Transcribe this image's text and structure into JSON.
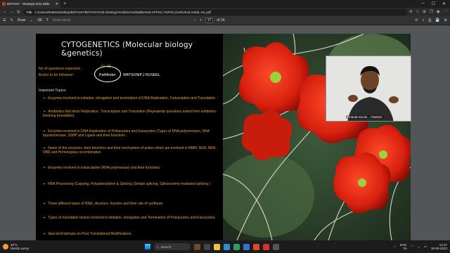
{
  "browser": {
    "tab_title": "BOTANY - Strategic time table",
    "address_prefix": "File",
    "url": "C:/Users/91961/Desktop/BOTANY/BOTANY%20-Strategic%20time%20table%20-APPSC,TSPSC,GURUKUL%20IL-DL.pdf"
  },
  "pdf_toolbar": {
    "draw_label": "Draw",
    "read_aloud_label": "Read aloud",
    "page_current": "17",
    "page_total": "of 24"
  },
  "slide": {
    "title": "CYTOGENETICS (Molecular biology &genetics)",
    "questions_label": "No of questions expected :",
    "questions_value": "10- 15",
    "books_label": "Books to be followed :",
    "book1": "Pathfinder",
    "book2": "WATSON/P.J RUSEEL",
    "topics_heading": "Important Topics:",
    "topics": [
      "Enzymes involved in initiation, elongation and termination of DNA Replication, Transcription and Translation.",
      "Antibiotics that block Replication, Transcription and Translation (Repeatedly questions asked from antibiotics blocking translation)",
      "Enzymes involved in DNA Replication of Prokaryotes and Eukaryotes (Types of DNA polymerases, DNA topoisomerase, SSBP and Ligase and their functions .",
      "Name of the enzymes, their functions and their mechanism of action which are involved in MMR, NER, BER, DBR and Homologous recombination",
      "Enzymes involved in transcription (RNA polymerase) and their functions.",
      "RNA Processing (Capping, Polyadenylation & Splicing (Simple splicing, Spliceosome mediated splicing )",
      "Three different types of RNA, structure, function and their site of synthesis",
      "Types of translation factors involved in initiation, elongation and Termination of Prokaryotes and Eukaryotes.",
      "Special Emphasis on Post Translational Modifications."
    ]
  },
  "webcam": {
    "label": "Chandu Ecolo... Classes"
  },
  "taskbar": {
    "temperature": "30°C",
    "weather": "Mostly sunny",
    "search_placeholder": "Search",
    "language": "ENG",
    "language_sub": "IN",
    "time": "12:47",
    "date": "30-05-2023"
  }
}
